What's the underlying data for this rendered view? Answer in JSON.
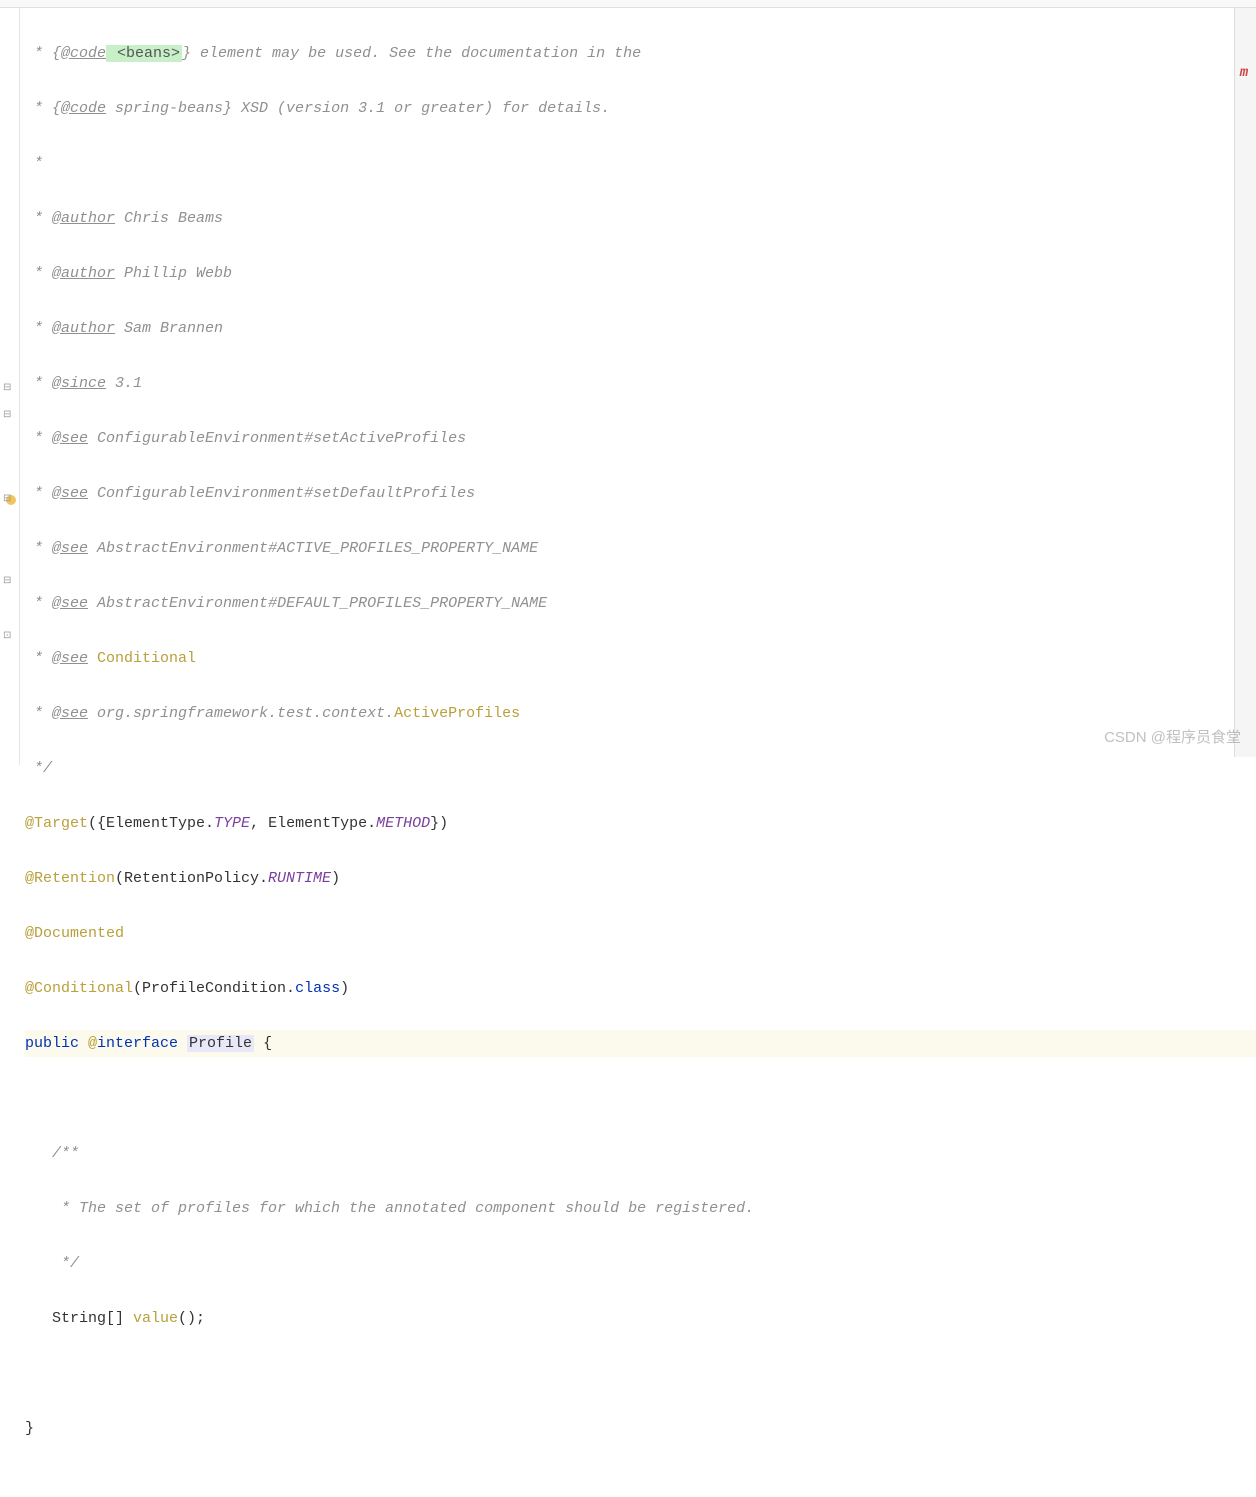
{
  "lines": {
    "l1_pre": " * {",
    "l1_tag": "@code",
    "l1_hl": " <beans>",
    "l1_post": "} element may be used. See the documentation in the",
    "l2_pre": " * {",
    "l2_tag": "@code",
    "l2_post": " spring-beans} XSD (version 3.1 or greater) for details.",
    "l3": " *",
    "l4_pre": " * ",
    "l4_tag": "@author",
    "l4_txt": " Chris Beams",
    "l5_pre": " * ",
    "l5_tag": "@author",
    "l5_txt": " Phillip Webb",
    "l6_pre": " * ",
    "l6_tag": "@author",
    "l6_txt": " Sam Brannen",
    "l7_pre": " * ",
    "l7_tag": "@since",
    "l7_txt": " 3.1",
    "l8_pre": " * ",
    "l8_tag": "@see",
    "l8_cls": " ConfigurableEnvironment",
    "l8_meth": "#setActiveProfiles",
    "l9_pre": " * ",
    "l9_tag": "@see",
    "l9_cls": " ConfigurableEnvironment",
    "l9_meth": "#setDefaultProfiles",
    "l10_pre": " * ",
    "l10_tag": "@see",
    "l10_cls": " AbstractEnvironment",
    "l10_meth": "#ACTIVE_PROFILES_PROPERTY_NAME",
    "l11_pre": " * ",
    "l11_tag": "@see",
    "l11_cls": " AbstractEnvironment",
    "l11_meth": "#DEFAULT_PROFILES_PROPERTY_NAME",
    "l12_pre": " * ",
    "l12_tag": "@see",
    "l12_ref": " Conditional",
    "l13_pre": " * ",
    "l13_tag": "@see",
    "l13_pkg": " org.springframework.test.context.",
    "l13_ref": "ActiveProfiles",
    "l14": " */",
    "l15_ann": "@Target",
    "l15_p1": "({ElementType.",
    "l15_c1": "TYPE",
    "l15_p2": ", ElementType.",
    "l15_c2": "METHOD",
    "l15_p3": "})",
    "l16_ann": "@Retention",
    "l16_p1": "(RetentionPolicy.",
    "l16_c1": "RUNTIME",
    "l16_p2": ")",
    "l17_ann": "@Documented",
    "l18_ann": "@Conditional",
    "l18_p1": "(ProfileCondition.",
    "l18_kw": "class",
    "l18_p2": ")",
    "l19_kw1": "public ",
    "l19_at": "@",
    "l19_kw2": "interface ",
    "l19_name": "Profile",
    "l19_brace": " {",
    "l20": "",
    "l21": "   /**",
    "l22": "    * The set of profiles for which the annotated component should be registered.",
    "l23": "    */",
    "l24_indent": "   ",
    "l24_type": "String[] ",
    "l24_meth": "value",
    "l24_end": "();",
    "l25": "",
    "l26": "}"
  },
  "watermark": "CSDN @程序员食堂",
  "maven_label": "m"
}
